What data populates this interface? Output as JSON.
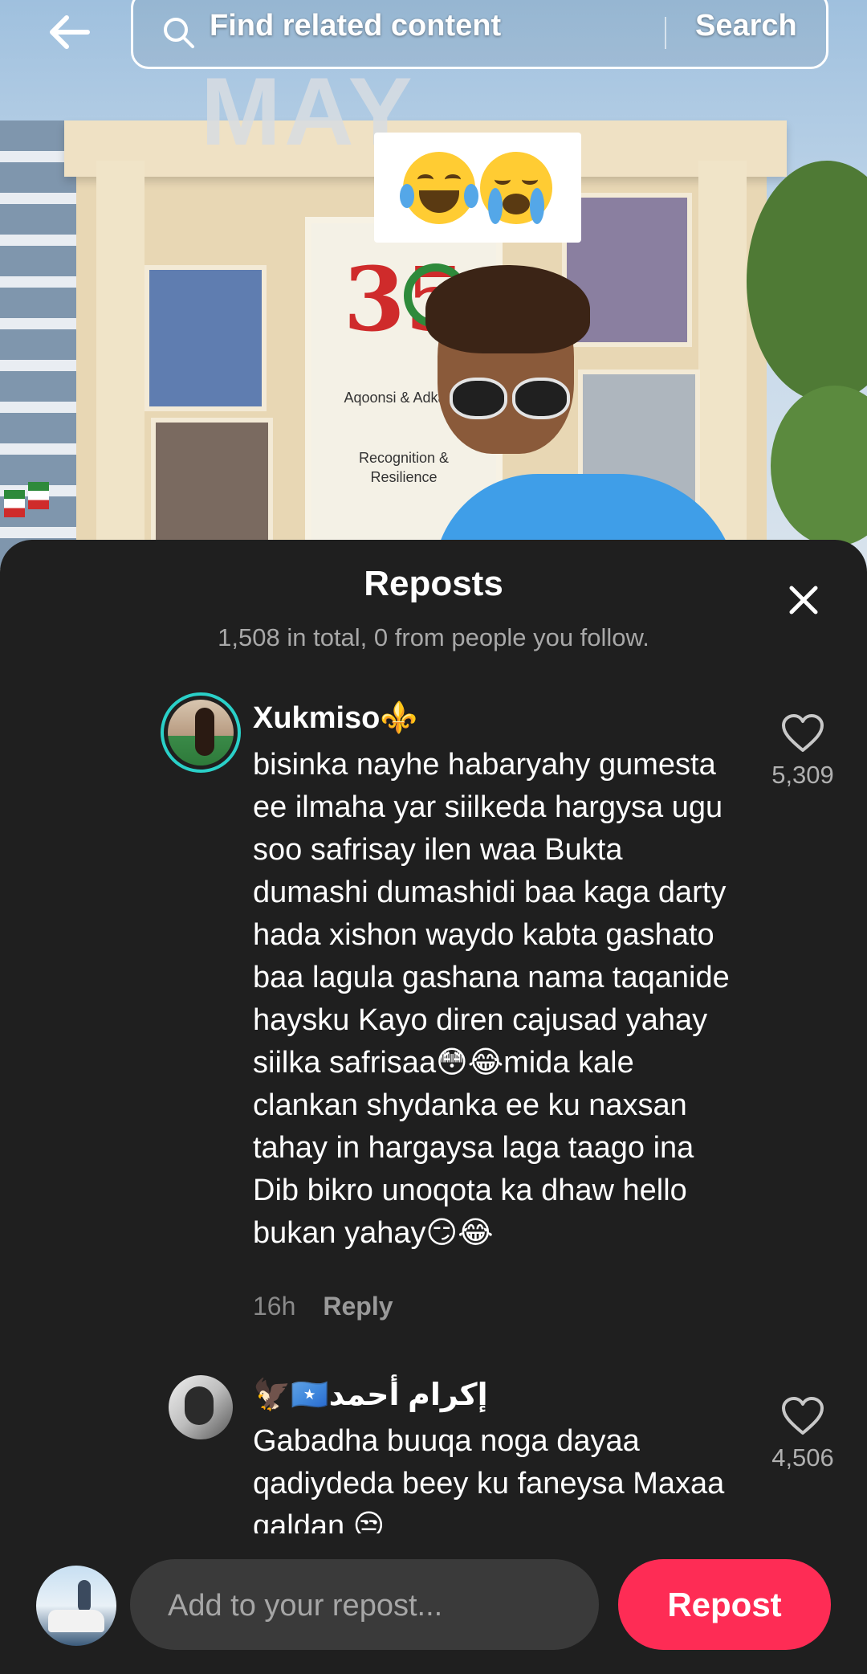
{
  "search": {
    "placeholder": "Find related content",
    "button_label": "Search"
  },
  "video": {
    "sticker_emoji": "😂😭",
    "poster_number": "35",
    "poster_line1": "Aqoonsi & Adkaysi",
    "poster_line2": "Recognition & Resilience",
    "sign_text": "MAY"
  },
  "sheet": {
    "title": "Reposts",
    "subtitle": "1,508 in total, 0 from people you follow."
  },
  "comments": [
    {
      "username": "Xukmiso⚜️",
      "text": "bisinka nayhe habaryahy gumesta ee ilmaha yar siilkeda hargysa ugu soo safrisay ilen waa Bukta dumashi dumashidi baa kaga darty hada xishon waydo kabta gashato baa lagula gashana nama taqanide haysku Kayo diren cajusad yahay siilka safrisaa😳😂mida kale clankan shydanka ee ku naxsan tahay in hargaysa laga taago ina Dib bikro unoqota ka dhaw hello bukan yahay😏😂",
      "time": "16h",
      "reply_label": "Reply",
      "likes": "5,309"
    },
    {
      "username": "🦅🇸🇴إكرام أحمد",
      "text": "Gabadha buuqa noga dayaa qadiydeda beey ku faneysa Maxaa qaldan 😒",
      "likes": "4,506"
    }
  ],
  "composer": {
    "placeholder": "Add to your repost...",
    "button_label": "Repost"
  },
  "colors": {
    "sheet_bg": "#1f1f1f",
    "accent": "#fe2c55",
    "avatar_ring": "#2ad0c8"
  },
  "icons": [
    "back-arrow-icon",
    "search-icon",
    "close-icon",
    "heart-icon"
  ]
}
